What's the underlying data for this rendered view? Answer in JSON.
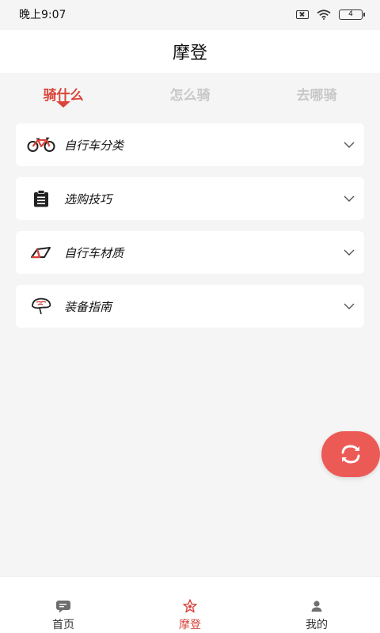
{
  "status_bar": {
    "time": "晚上9:07",
    "battery": "4"
  },
  "header": {
    "title": "摩登"
  },
  "tabs": [
    {
      "label": "骑什么",
      "active": true
    },
    {
      "label": "怎么骑",
      "active": false
    },
    {
      "label": "去哪骑",
      "active": false
    }
  ],
  "categories": [
    {
      "label": "自行车分类",
      "icon": "bicycle-icon"
    },
    {
      "label": "选购技巧",
      "icon": "clipboard-icon"
    },
    {
      "label": "自行车材质",
      "icon": "bike-frame-icon"
    },
    {
      "label": "装备指南",
      "icon": "helmet-icon"
    }
  ],
  "fab": {
    "icon": "refresh-icon"
  },
  "bottom_nav": [
    {
      "label": "首页",
      "icon": "message-icon",
      "active": false
    },
    {
      "label": "摩登",
      "icon": "star-icon",
      "active": true
    },
    {
      "label": "我的",
      "icon": "user-icon",
      "active": false
    }
  ],
  "colors": {
    "accent": "#d9443b",
    "fab": "#ec5a56",
    "inactive_tab": "#c8c8c8",
    "background": "#f5f5f5"
  }
}
